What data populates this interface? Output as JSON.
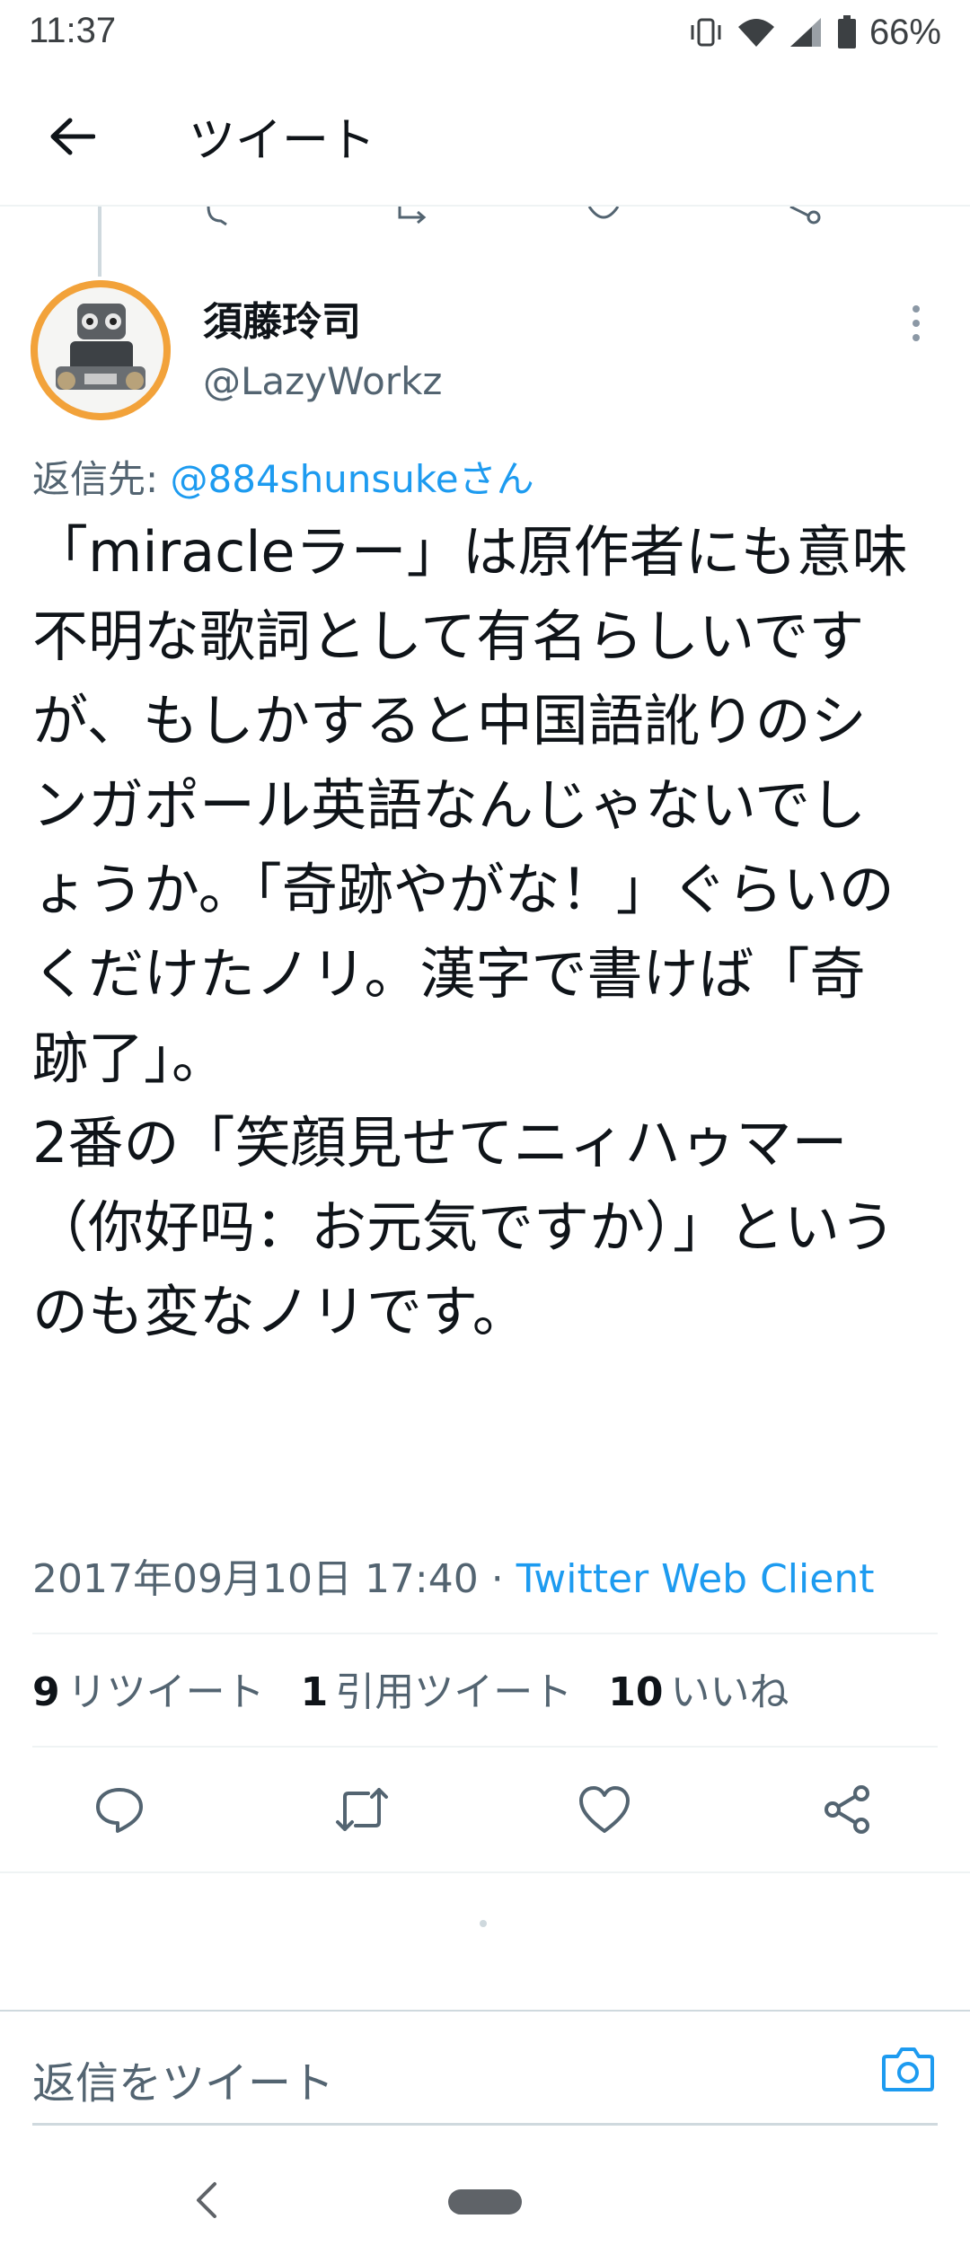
{
  "status_bar": {
    "time": "11:37",
    "battery": "66%",
    "icons": [
      "vibrate-icon",
      "wifi-icon",
      "signal-icon",
      "battery-icon"
    ]
  },
  "app_bar": {
    "title": "ツイート",
    "back_icon": "arrow-left-icon"
  },
  "tweet": {
    "author_name": "須藤玲司",
    "author_handle": "@LazyWorkz",
    "reply_to_label": "返信先: ",
    "reply_to_user": "@884shunsukeさん",
    "text": "「miracleラー」は原作者にも意味不明な歌詞として有名らしいですが、もしかすると中国語訛りのシンガポール英語なんじゃないでしょうか。「奇跡やがな！」ぐらいのくだけたノリ。漢字で書けば「奇跡了」。\n2番の「笑顔見せてニィハゥマー（你好吗：お元気ですか）」というのも変なノリです。",
    "timestamp": "2017年09月10日 17:40 · ",
    "client": "Twitter Web Client"
  },
  "stats": {
    "retweets": {
      "count": "9",
      "label": "リツイート"
    },
    "quotes": {
      "count": "1",
      "label": "引用ツイート"
    },
    "likes": {
      "count": "10",
      "label": "いいね"
    }
  },
  "actions": [
    "reply-icon",
    "retweet-icon",
    "like-icon",
    "share-icon"
  ],
  "reply_bar": {
    "placeholder": "返信をツイート",
    "camera_icon": "camera-icon"
  },
  "colors": {
    "accent": "#1d9bf0",
    "text_primary": "#0f1419",
    "text_secondary": "#536471",
    "divider": "#eff3f4"
  }
}
